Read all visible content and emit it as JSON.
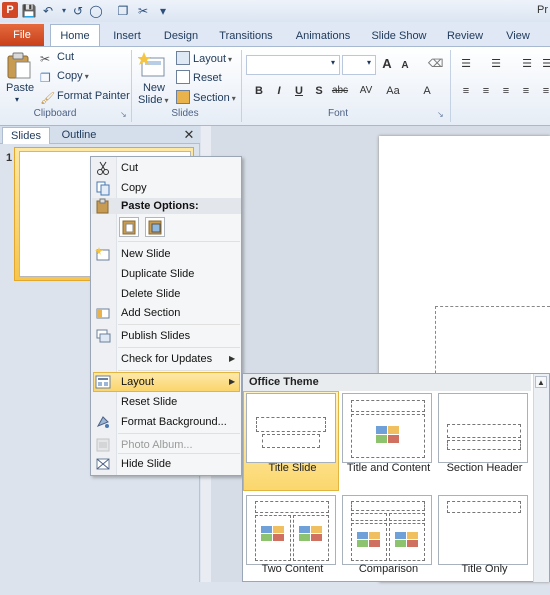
{
  "app": {
    "title_fragment": "Pr"
  },
  "ribbon_tabs": [
    "File",
    "Home",
    "Insert",
    "Design",
    "Transitions",
    "Animations",
    "Slide Show",
    "Review",
    "View"
  ],
  "clipboard": {
    "paste": "Paste",
    "cut": "Cut",
    "copy": "Copy",
    "format_painter": "Format Painter",
    "group": "Clipboard"
  },
  "slides_group": {
    "new_slide": "New\nSlide",
    "new_slide_l1": "New",
    "new_slide_l2": "Slide",
    "layout": "Layout",
    "reset": "Reset",
    "section": "Section",
    "group": "Slides"
  },
  "font_group": {
    "group": "Font"
  },
  "pane": {
    "tab_slides": "Slides",
    "tab_outline": "Outline",
    "close": "✕",
    "slide_number": "1"
  },
  "context_menu": {
    "cut": "Cut",
    "copy": "Copy",
    "paste_options": "Paste Options:",
    "new_slide": "New Slide",
    "duplicate_slide": "Duplicate Slide",
    "delete_slide": "Delete Slide",
    "add_section": "Add Section",
    "publish_slides": "Publish Slides",
    "check_updates": "Check for Updates",
    "layout": "Layout",
    "reset_slide": "Reset Slide",
    "format_background": "Format Background...",
    "photo_album": "Photo Album...",
    "hide_slide": "Hide Slide"
  },
  "layout_menu": {
    "header": "Office Theme",
    "layouts": [
      "Title Slide",
      "Title and Content",
      "Section Header",
      "Two Content",
      "Comparison",
      "Title Only"
    ],
    "selected": "Title Slide"
  },
  "colors": {
    "file_tab": "#c8401a",
    "highlight": "#fbd56b",
    "ribbon_text": "#1e395b"
  }
}
